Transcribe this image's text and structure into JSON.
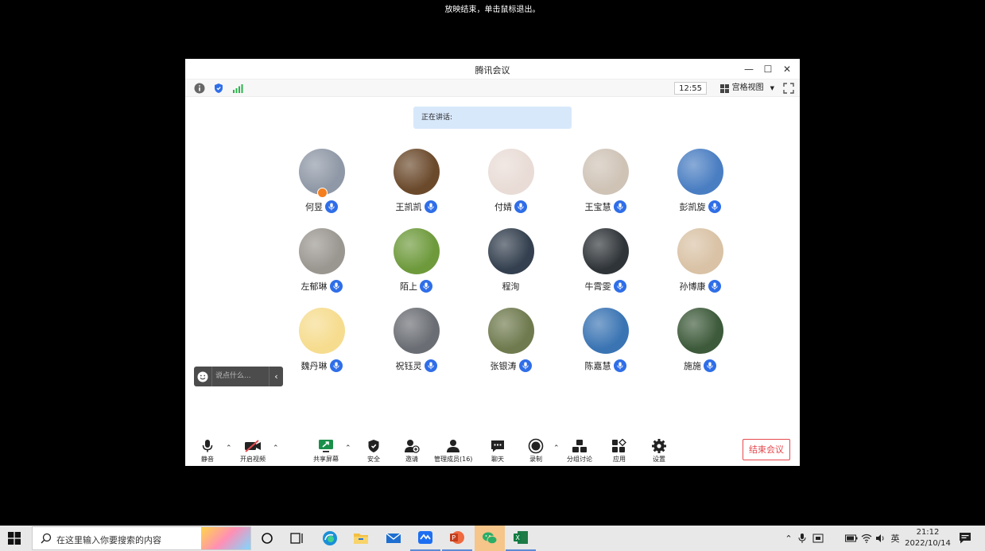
{
  "top_hint": "放映结束，单击鼠标退出。",
  "window": {
    "title": "腾讯会议",
    "controls": {
      "minimize": "—",
      "maximize": "☐",
      "close": "✕"
    }
  },
  "infobar": {
    "clock": "12:55",
    "view_label": "宫格视图"
  },
  "speaking_label": "正在讲话:",
  "participants": [
    {
      "name": "何昱",
      "color": "#8f98a6"
    },
    {
      "name": "王凯凯",
      "color": "#6b4a2c"
    },
    {
      "name": "付婧",
      "color": "#e9dcd6"
    },
    {
      "name": "王宝慧",
      "color": "#cfc3b6"
    },
    {
      "name": "彭凯旋",
      "color": "#4a7ec2"
    },
    {
      "name": "左郁琳",
      "color": "#9a9690"
    },
    {
      "name": "陌上",
      "color": "#6e9a3c"
    },
    {
      "name": "程洵",
      "color": "#34404f"
    },
    {
      "name": "牛霄雯",
      "color": "#2f3438"
    },
    {
      "name": "孙博康",
      "color": "#d9c2a5"
    },
    {
      "name": "魏丹琳",
      "color": "#f6dc8e"
    },
    {
      "name": "祝钰灵",
      "color": "#6a6d73"
    },
    {
      "name": "张银涛",
      "color": "#6f7a4e"
    },
    {
      "name": "陈嘉慧",
      "color": "#3a74b3"
    },
    {
      "name": "施施",
      "color": "#3d5a3a"
    }
  ],
  "chat": {
    "placeholder": "说点什么...",
    "collapse": "‹"
  },
  "toolbar": {
    "mute": "静音",
    "video": "开启视频",
    "share": "共享屏幕",
    "security": "安全",
    "invite": "邀请",
    "members": "管理成员(16)",
    "chat": "聊天",
    "record": "录制",
    "breakout": "分组讨论",
    "apps": "应用",
    "settings": "设置",
    "end": "结束会议"
  },
  "taskbar": {
    "search_placeholder": "在这里输入你要搜索的内容",
    "ime": "英",
    "time": "21:12",
    "date": "2022/10/14"
  }
}
